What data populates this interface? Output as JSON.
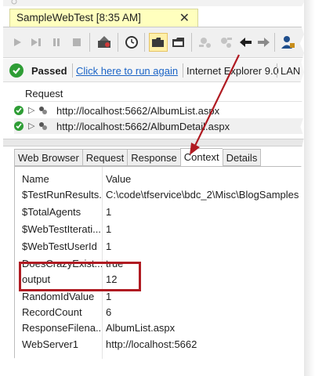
{
  "window": {
    "tab_title": "SampleWebTest [8:35 AM]",
    "tab_close_glyph": "✕"
  },
  "toolbar": {
    "buttons": [
      {
        "name": "run-icon"
      },
      {
        "name": "step-icon"
      },
      {
        "name": "pause-icon"
      },
      {
        "name": "stop-icon"
      },
      {
        "name": "recorder-icon"
      },
      {
        "name": "clock-icon"
      },
      {
        "name": "open-folder-icon"
      },
      {
        "name": "folder-icon"
      },
      {
        "name": "parameterize-icon"
      },
      {
        "name": "extract-icon"
      },
      {
        "name": "back-arrow-icon"
      },
      {
        "name": "forward-arrow-icon"
      },
      {
        "name": "user-icon"
      }
    ]
  },
  "status": {
    "result": "Passed",
    "rerun_link": "Click here to run again",
    "browser": "Internet Explorer 9.0",
    "network": "LAN",
    "accent": "#2e9d35"
  },
  "requests": {
    "header": "Request",
    "rows": [
      {
        "url": "http://localhost:5662/AlbumList.aspx"
      },
      {
        "url": "http://localhost:5662/AlbumDetail.aspx"
      }
    ]
  },
  "detail_tabs": [
    {
      "label": "Web Browser"
    },
    {
      "label": "Request"
    },
    {
      "label": "Response"
    },
    {
      "label": "Context"
    },
    {
      "label": "Details"
    }
  ],
  "context_grid": {
    "columns": {
      "name": "Name",
      "value": "Value"
    },
    "rows": [
      {
        "name": "$TestRunResults...",
        "value": "C:\\code\\tfservice\\bdc_2\\Misc\\BlogSamples"
      },
      {
        "name": "$TotalAgents",
        "value": "1"
      },
      {
        "name": "$WebTestIterati...",
        "value": "1"
      },
      {
        "name": "$WebTestUserId",
        "value": "1"
      },
      {
        "name": "DoesCrazyExist...",
        "value": "true"
      },
      {
        "name": "output",
        "value": "12"
      },
      {
        "name": "RandomIdValue",
        "value": "1"
      },
      {
        "name": "RecordCount",
        "value": "6"
      },
      {
        "name": "ResponseFilena...",
        "value": "AlbumList.aspx"
      },
      {
        "name": "WebServer1",
        "value": "http://localhost:5662"
      }
    ]
  },
  "annotation": {
    "color": "#b01b22"
  }
}
